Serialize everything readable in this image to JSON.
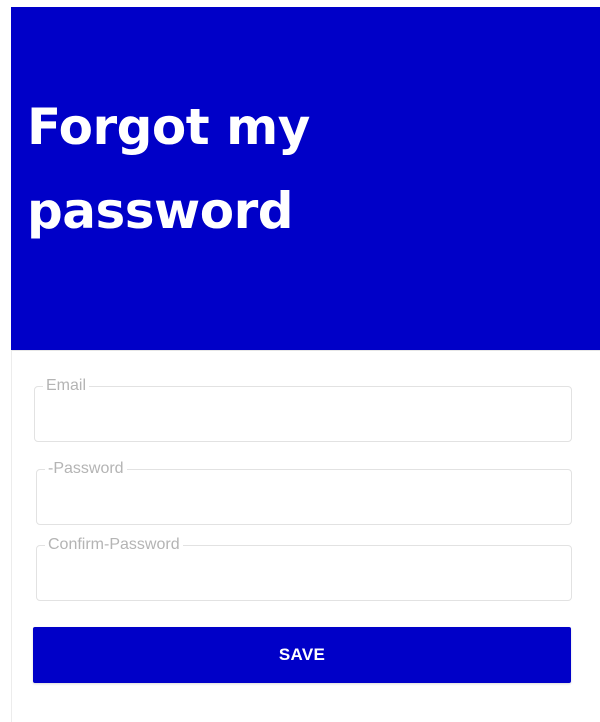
{
  "header": {
    "title_line1": "Forgot my",
    "title_line2": "password"
  },
  "form": {
    "email": {
      "label": "Email",
      "value": ""
    },
    "password": {
      "label": "-Password",
      "value": ""
    },
    "confirm_password": {
      "label": "Confirm-Password",
      "value": ""
    },
    "save_label": "SAVE"
  },
  "colors": {
    "brand": "#0000c8",
    "border": "#e2e2e2",
    "label": "#b4b4b4"
  }
}
